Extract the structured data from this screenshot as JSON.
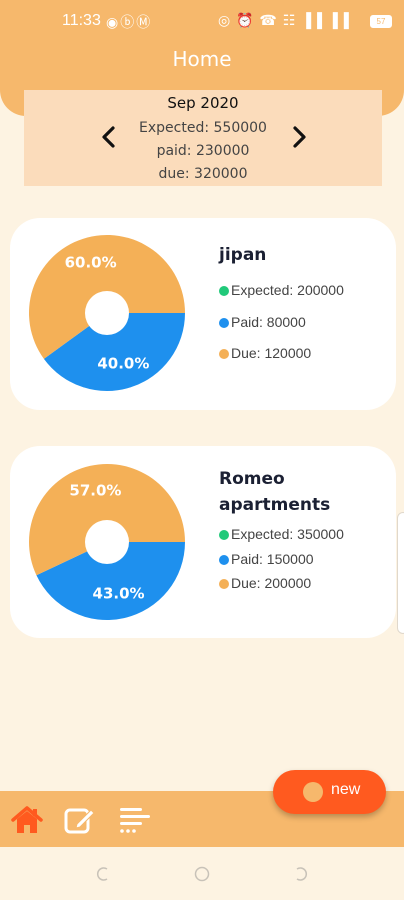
{
  "status_bar": {
    "time": "11:33",
    "left_icons": "◉ⓑⓂ",
    "right_icons": "◎ ⏰ ☎ ☷ ▐▐ ▐▐",
    "battery": "57"
  },
  "header": {
    "title": "Home"
  },
  "summary": {
    "month": "Sep 2020",
    "expected": "Expected: 550000",
    "paid": "paid: 230000",
    "due": "due: 320000"
  },
  "colors": {
    "accent": "#f6b86c",
    "expected": "#21c97a",
    "paid": "#1e90ee",
    "due": "#f4b057",
    "fab": "#ff5a1f"
  },
  "properties": [
    {
      "name": "jipan",
      "expected": "Expected: 200000",
      "paid": "Paid: 80000",
      "due": "Due: 120000",
      "due_pct_label": "60.0%",
      "paid_pct_label": "40.0%"
    },
    {
      "name": "Romeo apartments",
      "expected": "Expected: 350000",
      "paid": "Paid: 150000",
      "due": "Due: 200000",
      "due_pct_label": "57.0%",
      "paid_pct_label": "43.0%"
    }
  ],
  "chart_data": [
    {
      "type": "pie",
      "categories": [
        "Paid",
        "Due"
      ],
      "values": [
        40.0,
        60.0
      ],
      "title": "jipan"
    },
    {
      "type": "pie",
      "categories": [
        "Paid",
        "Due"
      ],
      "values": [
        43.0,
        57.0
      ],
      "title": "Romeo apartments"
    }
  ],
  "bottom_nav": {
    "items": [
      "home-icon",
      "edit-icon",
      "list-menu-icon"
    ]
  },
  "fab": {
    "label": "new"
  }
}
